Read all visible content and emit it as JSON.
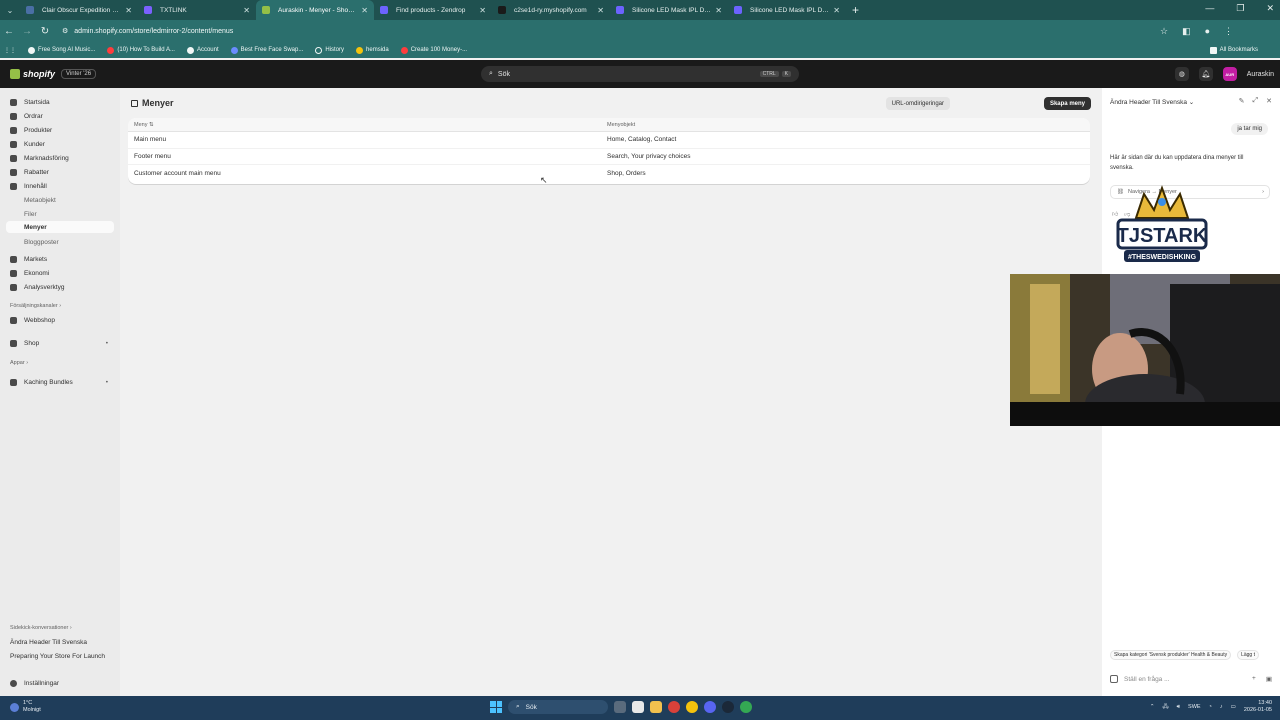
{
  "browser": {
    "tabs": [
      {
        "label": "Clair Obscur Expedition 33 – Di",
        "color": "#4a6fa5"
      },
      {
        "label": "TXTLINK",
        "color": "#7b61ff"
      },
      {
        "label": "Auraskin - Menyer - Shopify",
        "color": "#95bf47",
        "active": true
      },
      {
        "label": "Find products - Zendrop",
        "color": "#6c63ff"
      },
      {
        "label": "c2se1d-ry.myshopify.com",
        "color": "#1a1a1a"
      },
      {
        "label": "Silicone LED Mask IPL Device fo",
        "color": "#6c63ff"
      },
      {
        "label": "Silicone LED Mask IPL Device fo",
        "color": "#6c63ff"
      }
    ],
    "url": "admin.shopify.com/store/ledmirror-2/content/menus",
    "bookmarks": [
      {
        "label": "Free Song AI Music..."
      },
      {
        "label": "(10) How To Build A..."
      },
      {
        "label": "Account"
      },
      {
        "label": "Best Free Face Swap..."
      },
      {
        "label": "History"
      },
      {
        "label": "hemsida"
      },
      {
        "label": "Create 100 Money-..."
      }
    ],
    "all_bookmarks": "All Bookmarks"
  },
  "shopify": {
    "logo": "shopify",
    "edition": "Vinter '26",
    "search_placeholder": "Sök",
    "search_kbd": [
      "CTRL",
      "K"
    ],
    "store_name": "Auraskin",
    "avatar_initials": "AUR"
  },
  "sidebar": {
    "items": [
      {
        "label": "Startsida"
      },
      {
        "label": "Ordrar"
      },
      {
        "label": "Produkter"
      },
      {
        "label": "Kunder"
      },
      {
        "label": "Marknadsföring"
      },
      {
        "label": "Rabatter"
      },
      {
        "label": "Innehåll"
      },
      {
        "label": "Metaobjekt",
        "sub": true
      },
      {
        "label": "Filer",
        "sub": true
      },
      {
        "label": "Menyer",
        "sub": true,
        "active": true
      },
      {
        "label": "Bloggposter",
        "sub": true
      },
      {
        "label": "Markets"
      },
      {
        "label": "Ekonomi"
      },
      {
        "label": "Analysverktyg"
      }
    ],
    "sales_channels_label": "Försäljningskanaler",
    "webshop": "Webbshop",
    "shop": "Shop",
    "apps_label": "Appar",
    "kaching": "Kaching Bundles",
    "sidekick_label": "Sidekick-konversationer",
    "conversations": [
      "Ändra Header Till Svenska",
      "Preparing Your Store For Launch"
    ],
    "settings": "Inställningar"
  },
  "main": {
    "title": "Menyer",
    "url_redirects": "URL-omdirigeringar",
    "create_menu": "Skapa meny",
    "columns": [
      "Meny",
      "Menyobjekt"
    ],
    "rows": [
      {
        "menu": "Main menu",
        "items": "Home, Catalog, Contact"
      },
      {
        "menu": "Footer menu",
        "items": "Search, Your privacy choices"
      },
      {
        "menu": "Customer account main menu",
        "items": "Shop, Orders"
      }
    ]
  },
  "sidekick": {
    "title": "Ändra Header Till Svenska",
    "user_message": "ja tar mig",
    "bot_message": "Här är sidan där du kan uppdatera dina menyer till svenska.",
    "link": "Navigera → Menyer",
    "suggestions": [
      "Skapa kategori 'Svensk produkter' Health & Beauty",
      "Lägg t"
    ],
    "input_placeholder": "Ställ en fråga ..."
  },
  "overlay": {
    "logo_text": "TJSTARK",
    "logo_sub": "#THESWEDISHKING"
  },
  "taskbar": {
    "weather_temp": "1°C",
    "weather_desc": "Molnigt",
    "search": "Sök",
    "lang": "SWE",
    "time": "13:40",
    "date": "2026-01-05"
  },
  "colors": {
    "shopify_green": "#95bf47",
    "browser_teal": "#2b6f6d",
    "taskbar": "#1f3d5a"
  }
}
